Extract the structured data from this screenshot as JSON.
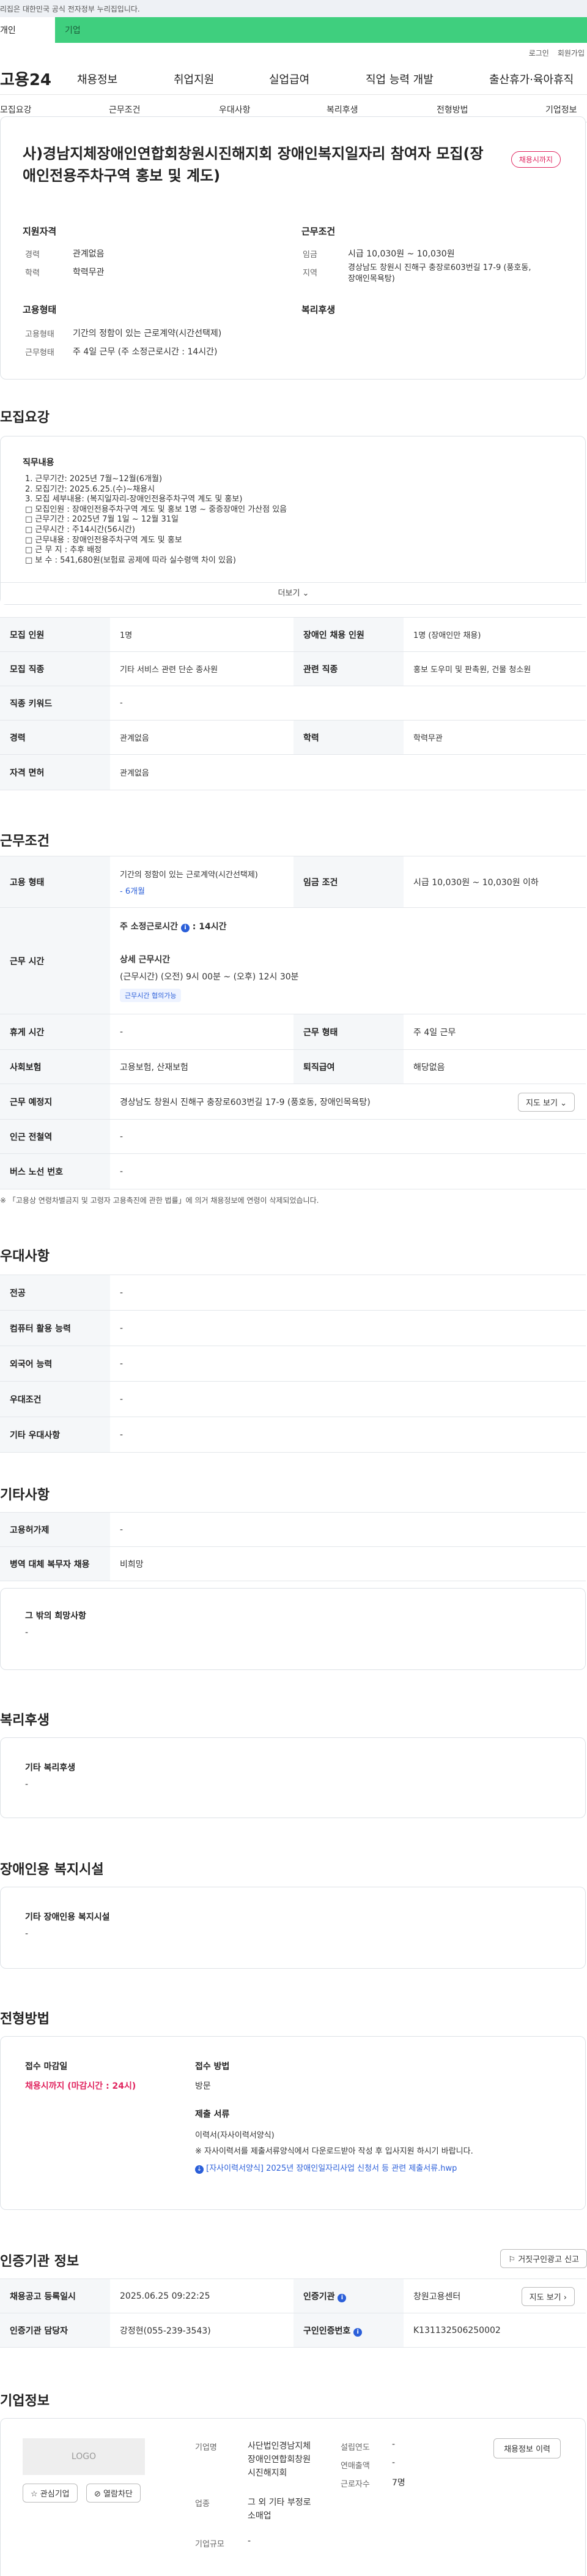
{
  "topbar": {
    "notice": "이 누리집은 대한민국 공식 전자정부 누리집입니다."
  },
  "tabs": {
    "personal": "개인",
    "company": "기업"
  },
  "util": {
    "login": "로그인",
    "signup": "회원가입"
  },
  "gnb": {
    "logo": "고용24",
    "items": [
      "채용정보",
      "취업지원",
      "실업급여",
      "직업 능력 개발",
      "출산휴가·육아휴직"
    ]
  },
  "lnb": {
    "items": [
      "모집요강",
      "근무조건",
      "우대사항",
      "복리후생",
      "전형방법",
      "기업정보"
    ]
  },
  "header": {
    "title_line1": "사)경남지체장애인연합회창원시진해지회 장애인복지일자리 참여자 모집(장",
    "title_line2": "애인전용주차구역 홍보 및 계도)",
    "badge": "채용시까지",
    "qual_title": "지원자격",
    "cond_title": "근무조건",
    "career_label": "경력",
    "career_value": "관계없음",
    "edu_label": "학력",
    "edu_value": "학력무관",
    "wage_label": "임금",
    "wage_value": "시급 10,030원 ~ 10,030원",
    "loc_label": "지역",
    "loc_value_1": "경상남도 창원시 진해구 충장로603번길 17-9 (풍호동,",
    "loc_value_2": "장애인목욕탕)",
    "emptype_title": "고용형태",
    "welfare_title": "복리후생",
    "emptype_label": "고용형태",
    "emptype_value": "기간의 정함이 있는 근로계약(시간선택제)",
    "worktype_label": "근무형태",
    "worktype_value": "주 4일 근무 (주 소정근로시간 : 14시간)"
  },
  "recruit": {
    "title": "모집요강",
    "duty_title": "직무내용",
    "lines": [
      "1. 근무기간: 2025년 7월~12월(6개월)",
      "2. 모집기간: 2025.6.25.(수)~채용시",
      "3. 모집 세부내용: (복지일자리-장애인전용주차구역 계도 및 홍보)",
      "□ 모집인원 : 장애인전용주차구역 계도 및 홍보 1명 ~ 중증장애인 가산점 있음",
      "□ 근무기간 : 2025년 7월 1일 ~ 12월 31일",
      "□ 근무시간 : 주14시간(56시간)",
      "□ 근무내용 : 장애인전용주차구역 계도 및 홍보",
      "□ 근 무 지 : 추후 배정",
      "□ 보    수 : 541,680원(보험료 공제에 따라 실수령액 차이 있음)"
    ],
    "more": "더보기",
    "rows": [
      {
        "l1": "모집 인원",
        "v1": "1명",
        "l2": "장애인 채용 인원",
        "v2": "1명 (장애인만 채용)"
      },
      {
        "l1": "모집 직종",
        "v1": "기타 서비스 관련 단순 종사원",
        "l2": "관련 직종",
        "v2": "홍보 도우미 및 판촉원, 건물 청소원"
      },
      {
        "l1": "직종 키워드",
        "v1": "-"
      },
      {
        "l1": "경력",
        "v1": "관계없음",
        "l2": "학력",
        "v2": "학력무관"
      },
      {
        "l1": "자격 면허",
        "v1": "관계없음"
      }
    ]
  },
  "work": {
    "title": "근무조건",
    "emptype_label": "고용 형태",
    "emptype_value": "기간의 정함이 있는 근로계약(시간선택제)",
    "emptype_sub": "- 6개월",
    "wage_label": "임금 조건",
    "wage_value": "시급 10,030원 ~ 10,030원 이하",
    "hours_label": "근무 시간",
    "hours_weekly": "주 소정근로시간",
    "hours_weekly_value": ": 14시간",
    "hours_detail_title": "상세 근무시간",
    "hours_detail": "(근무시간) (오전) 9시 00분 ~ (오후) 12시 30분",
    "hours_tag": "근무시간 협의가능",
    "rest_label": "휴게 시간",
    "rest_value": "-",
    "form_label": "근무 형태",
    "form_value": "주 4일 근무",
    "ins_label": "사회보험",
    "ins_value": "고용보험, 산재보험",
    "retire_label": "퇴직급여",
    "retire_value": "해당없음",
    "place_label": "근무 예정지",
    "place_value": "경상남도 창원시 진해구 충장로603번길 17-9 (풍호동, 장애인목욕탕)",
    "map_btn": "지도 보기",
    "subway_label": "인근 전철역",
    "subway_value": "-",
    "bus_label": "버스 노선 번호",
    "bus_value": "-",
    "notice": "※ 「고용상 연령차별금지 및 고령자 고용촉진에 관한 법률」에 의거 채용정보에 연령이 삭제되었습니다."
  },
  "pref": {
    "title": "우대사항",
    "rows": [
      {
        "l": "전공",
        "v": "-"
      },
      {
        "l": "컴퓨터 활용 능력",
        "v": "-"
      },
      {
        "l": "외국어 능력",
        "v": "-"
      },
      {
        "l": "우대조건",
        "v": "-"
      },
      {
        "l": "기타 우대사항",
        "v": "-"
      }
    ]
  },
  "etc": {
    "title": "기타사항",
    "rows": [
      {
        "l": "고용허가제",
        "v": "-"
      },
      {
        "l": "병역 대체 복무자 채용",
        "v": "비희망"
      }
    ],
    "hope_title": "그 밖의 희망사항",
    "hope_value": "-"
  },
  "welfare": {
    "title": "복리후생",
    "box_title": "기타 복리후생",
    "box_value": "-"
  },
  "facility": {
    "title": "장애인용 복지시설",
    "box_title": "기타 장애인용 복지시설",
    "box_value": "-"
  },
  "selection": {
    "title": "전형방법",
    "deadline_title": "접수 마감일",
    "deadline_value": "채용시까지 (마감시간 : 24시)",
    "method_title": "접수 방법",
    "method_value": "방문",
    "docs_title": "제출 서류",
    "docs_value": "이력서(자사이력서양식)",
    "docs_note": "※ 자사이력서를 제출서류양식에서 다운로드받아 작성 후 입사지원 하시기 바랍니다.",
    "docs_file": "[자사이력서양식] 2025년 장애인일자리사업 신청서 등 관련 제출서류.hwp"
  },
  "cert": {
    "title": "인증기관 정보",
    "report_btn": "거짓구인광고 신고",
    "reg_label": "채용공고 등록일시",
    "reg_value": "2025.06.25 09:22:25",
    "org_label": "인증기관",
    "org_value": "창원고용센터",
    "map_btn": "지도 보기",
    "mgr_label": "인증기관 담당자",
    "mgr_value": "강정현(055-239-3543)",
    "no_label": "구인인증번호",
    "no_value": "K131132506250002"
  },
  "company": {
    "title": "기업정보",
    "logo": "LOGO",
    "interest_btn": "관심기업",
    "block_btn": "열람차단",
    "name_label": "기업명",
    "name_value_1": "사단법인경남지체",
    "name_value_2": "장애인연합회창원",
    "name_value_3": "시진해지회",
    "found_label": "설립연도",
    "found_value": "-",
    "sales_label": "연매출액",
    "sales_value": "-",
    "staff_label": "근로자수",
    "staff_value": "7명",
    "industry_label": "업종",
    "industry_value_1": "그 외 기타 부정로",
    "industry_value_2": "소매업",
    "scale_label": "기업규모",
    "scale_value": "-",
    "jobs_btn": "채용정보 이력"
  },
  "colors": {
    "accent_green": "#3fcf7e",
    "pink": "#e0245e",
    "blue": "#2b5fd9"
  }
}
